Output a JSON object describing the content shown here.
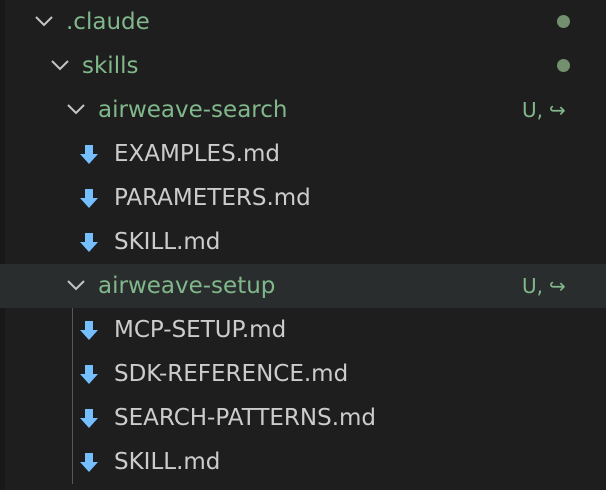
{
  "tree": {
    "root_folder": {
      "label": ".claude"
    },
    "skills_folder": {
      "label": "skills"
    },
    "search_folder": {
      "label": "airweave-search",
      "status": "U,",
      "files": [
        {
          "label": "EXAMPLES.md"
        },
        {
          "label": "PARAMETERS.md"
        },
        {
          "label": "SKILL.md"
        }
      ]
    },
    "setup_folder": {
      "label": "airweave-setup",
      "status": "U,",
      "files": [
        {
          "label": "MCP-SETUP.md"
        },
        {
          "label": "SDK-REFERENCE.md"
        },
        {
          "label": "SEARCH-PATTERNS.md"
        },
        {
          "label": "SKILL.md"
        }
      ]
    }
  },
  "icons": {
    "chevron": "chevron-down-icon",
    "file": "download-arrow-icon",
    "redirect": "redirect-arrow-icon",
    "modified_dot": "dot-icon"
  },
  "colors": {
    "background": "#1e1e1e",
    "selected_row": "#2a2d2e",
    "folder_text": "#81b88b",
    "file_text": "#cccccc",
    "file_icon": "#75beff",
    "dot": "#73906e"
  }
}
